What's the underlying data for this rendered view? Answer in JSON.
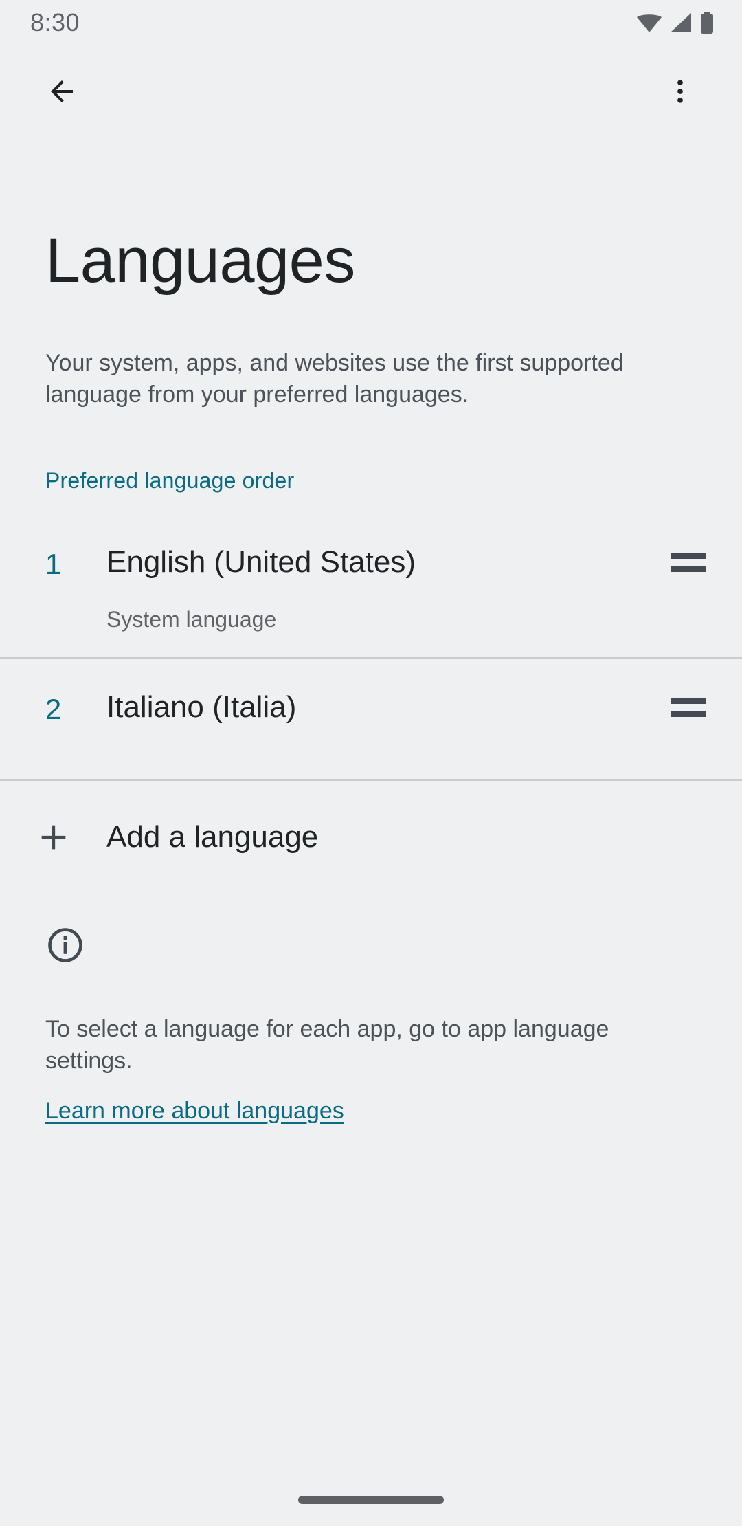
{
  "status_bar": {
    "time": "8:30",
    "icons": [
      "wifi-icon",
      "cellular-signal-icon",
      "battery-icon"
    ]
  },
  "app_bar": {
    "back_icon": "back-arrow-icon",
    "overflow_icon": "more-options-icon"
  },
  "page": {
    "title": "Languages",
    "description": "Your system, apps, and websites use the first supported language from your preferred languages."
  },
  "section": {
    "header": "Preferred language order"
  },
  "languages": [
    {
      "index": "1",
      "name": "English (United States)",
      "subtitle": "System language",
      "handle_icon": "drag-handle-icon"
    },
    {
      "index": "2",
      "name": "Italiano (Italia)",
      "subtitle": "",
      "handle_icon": "drag-handle-icon"
    }
  ],
  "add_language": {
    "label": "Add a language",
    "icon": "plus-icon"
  },
  "footer": {
    "icon": "info-circle-icon",
    "text": "To select a language for each app, go to app language settings.",
    "link_label": "Learn more about languages"
  },
  "colors": {
    "background": "#eff0f1",
    "accent": "#0b6a84",
    "primary_text": "#1f2326",
    "secondary_text": "#4c5257",
    "tertiary_text": "#5f6368",
    "divider": "#c9cbcd",
    "icon": "#434a51"
  }
}
